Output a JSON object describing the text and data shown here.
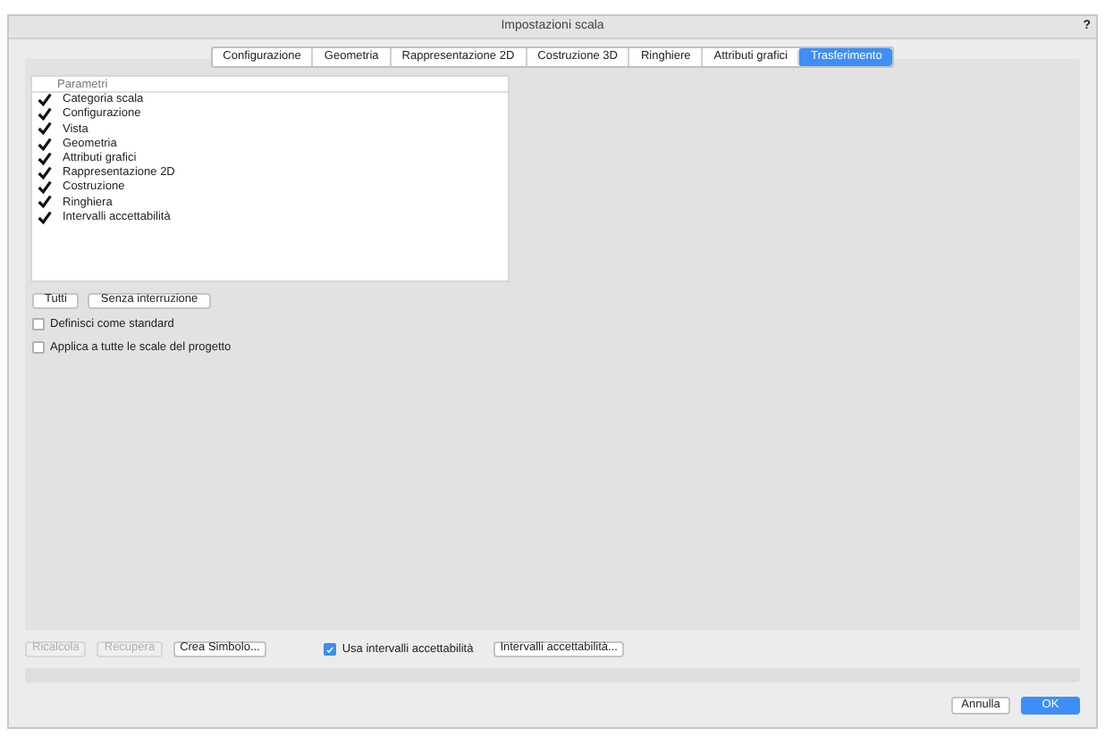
{
  "window": {
    "title": "Impostazioni scala",
    "help": "?"
  },
  "tabs": [
    {
      "label": "Configurazione",
      "selected": false
    },
    {
      "label": "Geometria",
      "selected": false
    },
    {
      "label": "Rappresentazione 2D",
      "selected": false
    },
    {
      "label": "Costruzione 3D",
      "selected": false
    },
    {
      "label": "Ringhiere",
      "selected": false
    },
    {
      "label": "Attributi grafici",
      "selected": false
    },
    {
      "label": "Trasferimento",
      "selected": true
    }
  ],
  "list": {
    "header": "Parametri",
    "items": [
      {
        "label": "Categoria scala",
        "checked": true
      },
      {
        "label": "Configurazione",
        "checked": true
      },
      {
        "label": "Vista",
        "checked": true
      },
      {
        "label": "Geometria",
        "checked": true
      },
      {
        "label": "Attributi grafici",
        "checked": true
      },
      {
        "label": "Rappresentazione 2D",
        "checked": true
      },
      {
        "label": "Costruzione",
        "checked": true
      },
      {
        "label": "Ringhiera",
        "checked": true
      },
      {
        "label": "Intervalli accettabilità",
        "checked": true
      }
    ]
  },
  "list_buttons": [
    "Tutti",
    "Senza interruzione"
  ],
  "options": [
    {
      "label": "Definisci come standard",
      "checked": false
    },
    {
      "label": "Applica a tutte le scale del progetto",
      "checked": false
    }
  ],
  "actions": [
    {
      "label": "Ricalcola",
      "disabled": true
    },
    {
      "label": "Recupera",
      "disabled": true
    },
    {
      "label": "Crea Simbolo...",
      "disabled": false
    }
  ],
  "use_ranges": {
    "label": "Usa intervalli accettabilità",
    "checked": true
  },
  "ranges_button": "Intervalli accettabilità...",
  "progress": {
    "level": 0
  },
  "footer": [
    {
      "label": "Annulla",
      "kind": "secondary"
    },
    {
      "label": "OK",
      "kind": "primary"
    }
  ]
}
